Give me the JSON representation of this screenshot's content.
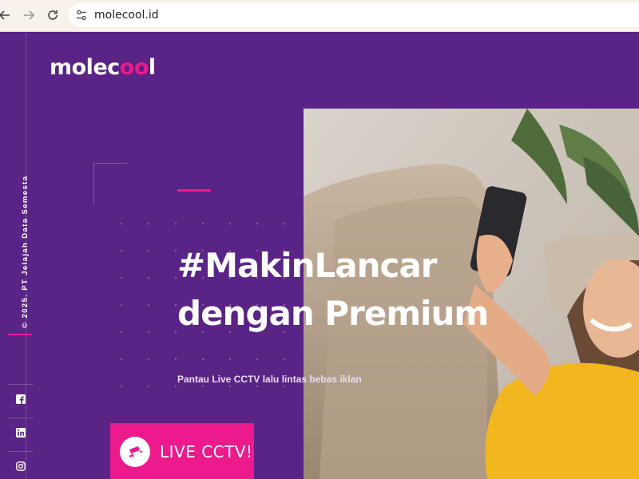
{
  "browser": {
    "url": "molecool.id",
    "back_icon": "arrow-left-icon",
    "forward_icon": "arrow-right-icon",
    "reload_icon": "reload-icon",
    "site_info_icon": "tune-icon"
  },
  "header": {
    "logo_pre": "molec",
    "logo_accent": "oo",
    "logo_post": "l"
  },
  "sidebar": {
    "copyright": "© 2025. PT Jelajah Data Semesta",
    "social": [
      {
        "name": "facebook",
        "icon": "facebook-icon"
      },
      {
        "name": "linkedin",
        "icon": "linkedin-icon"
      },
      {
        "name": "instagram",
        "icon": "instagram-icon"
      }
    ]
  },
  "hero": {
    "headline_line1": "#MakinLancar",
    "headline_line2": "dengan Premium",
    "subline": "Pantau Live CCTV lalu lintas bebas iklan",
    "cta_label": "LIVE CCTV!",
    "cta_icon": "cctv-camera-icon"
  },
  "colors": {
    "background": "#5a2386",
    "accent": "#ec1a8c",
    "toolbar": "#f8f2ea"
  }
}
